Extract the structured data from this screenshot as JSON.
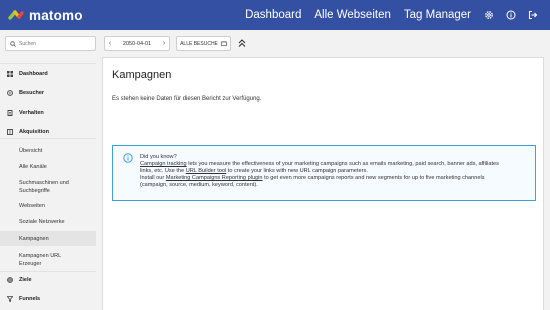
{
  "app": {
    "logo_text": "matomo"
  },
  "topnav": {
    "dashboard": "Dashboard",
    "all_websites": "Alle Webseiten",
    "tag_manager": "Tag Manager",
    "icons": [
      "gear-icon",
      "help-icon",
      "logout-icon"
    ]
  },
  "search": {
    "placeholder": "Suchen"
  },
  "date_selector": {
    "value": "2050-04-01"
  },
  "segment": {
    "label": "ALLE BESUCHE"
  },
  "sidebar": {
    "items": [
      {
        "label": "Dashboard",
        "icon": "dashboard-icon",
        "kind": "category"
      },
      {
        "label": "Besucher",
        "icon": "visitors-icon",
        "kind": "category"
      },
      {
        "label": "Verhalten",
        "icon": "behaviour-icon",
        "kind": "category"
      },
      {
        "label": "Akquisition",
        "icon": "acquisition-icon",
        "kind": "category"
      },
      {
        "label": "Übersicht",
        "kind": "sub"
      },
      {
        "label": "Alle Kanäle",
        "kind": "sub"
      },
      {
        "label": "Suchmaschinen und Suchbegriffe",
        "kind": "sub"
      },
      {
        "label": "Webseiten",
        "kind": "sub"
      },
      {
        "label": "Soziale Netzwerke",
        "kind": "sub"
      },
      {
        "label": "Kampagnen",
        "kind": "sub",
        "active": true
      },
      {
        "label": "Kampagnen URL Erzeuger",
        "kind": "sub"
      },
      {
        "label": "Ziele",
        "icon": "goals-icon",
        "kind": "category"
      },
      {
        "label": "Funnels",
        "icon": "funnel-icon",
        "kind": "category"
      }
    ]
  },
  "main": {
    "title": "Kampagnen",
    "no_data": "Es stehen keine Daten für diesen Bericht zur Verfügung.",
    "info": {
      "heading": "Did you know?",
      "l1_link": "Campaign tracking",
      "l1_rest": " lets you measure the effectiveness of your marketing campaigns such as emails marketing, paid search, banner ads, affiliates",
      "l2_pre": "links, etc. Use the ",
      "l2_link": "URL Builder tool",
      "l2_rest": " to create your links with new URL campaign parameters.",
      "l3_pre": "Install our ",
      "l3_link": "Marketing Campaigns Reporting plugin",
      "l3_rest": " to get even more campaigns reports and new segments for up to five marketing channels",
      "l4": "(campaign, source, medium, keyword, content)."
    }
  },
  "colors": {
    "topbar": "#3450a3",
    "info_border": "#3ea0d8",
    "logo_green": "#95c748",
    "logo_yellow": "#f6b81e",
    "logo_red": "#e8463c"
  }
}
